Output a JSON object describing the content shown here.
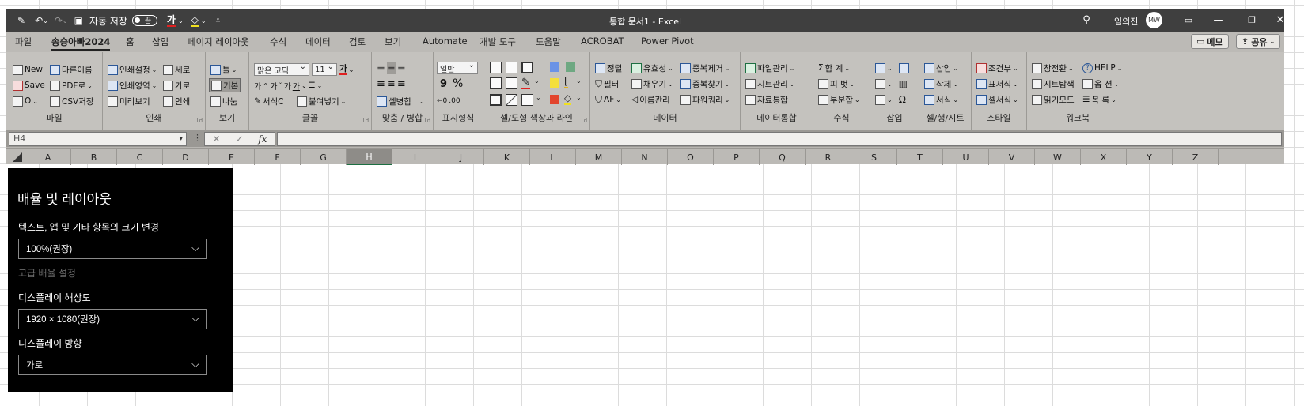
{
  "titlebar": {
    "autosave_label": "자동 저장",
    "autosave_state": "끔",
    "font_color_glyph": "가",
    "document_title": "통합 문서1  -  Excel",
    "user_name": "임의진",
    "avatar_text": "MW"
  },
  "menu": {
    "items": [
      "파일",
      "송승아빠2024",
      "홈",
      "삽입",
      "페이지 레이아웃",
      "수식",
      "데이터",
      "검토",
      "보기",
      "Automate",
      "개발 도구",
      "도움말",
      "ACROBAT",
      "Power Pivot"
    ],
    "memo_label": "메모",
    "share_label": "공유"
  },
  "ribbon": {
    "file": {
      "new": "New",
      "other_name": "다른이름",
      "save": "Save",
      "pdf": "PDF로",
      "o": "O",
      "csv": "CSV저장",
      "label": "파일"
    },
    "print": {
      "print_setup": "인쇄설정",
      "vertical": "세로",
      "print_area": "인쇄영역",
      "horizontal": "가로",
      "preview": "미리보기",
      "print": "인쇄",
      "label": "인쇄"
    },
    "view": {
      "frame": "틀",
      "basic": "기본",
      "split": "나눔",
      "label": "보기"
    },
    "font": {
      "font_name": "맑은 고딕",
      "font_size": "11",
      "font_color": "가",
      "format": "서식C",
      "paste": "붙여넣기",
      "label": "글꼴"
    },
    "align": {
      "merge": "셀병합",
      "label": "맞춤 / 병합"
    },
    "number": {
      "format": "일반",
      "comma": "9",
      "percent": "%",
      "label": "표시형식"
    },
    "cell_color": {
      "label": "셀/도형 색상과 라인"
    },
    "data": {
      "sort": "정렬",
      "validate": "유효성",
      "dedupe": "중복제거",
      "filter": "필터",
      "fill": "채우기",
      "find_dup": "중복찾기",
      "af": "AF",
      "name_mgr": "이름관리",
      "power_query": "파워쿼리",
      "label": "데이터"
    },
    "consolidate": {
      "file_mgr": "파일관리",
      "sheet_mgr": "시트관리",
      "data_merge": "자료통합",
      "label": "데이터통합"
    },
    "formula": {
      "sum": "합  계",
      "pivot": "피  벗",
      "subtotal": "부분합",
      "label": "수식"
    },
    "insert": {
      "label": "삽입"
    },
    "cells": {
      "insert": "삽입",
      "delete": "삭제",
      "format": "서식",
      "label": "셀/행/시트"
    },
    "style": {
      "conditional": "조건부",
      "table_format": "표서식",
      "cell_style": "셀서식",
      "label": "스타일"
    },
    "workbook": {
      "switch": "창전환",
      "help": "HELP",
      "sheet_explorer": "시트탐색",
      "options": "옵  션",
      "reading": "읽기모드",
      "toc": "목  록",
      "label": "워크북"
    }
  },
  "formula_bar": {
    "name_box": "H4",
    "fx": "fx"
  },
  "columns": [
    "A",
    "B",
    "C",
    "D",
    "E",
    "F",
    "G",
    "H",
    "I",
    "J",
    "K",
    "L",
    "M",
    "N",
    "O",
    "P",
    "Q",
    "R",
    "S",
    "T",
    "U",
    "V",
    "W",
    "X",
    "Y",
    "Z"
  ],
  "selected_column": "H",
  "settings": {
    "title": "배율 및 레이아웃",
    "scale_label": "텍스트, 앱 및 기타 항목의 크기 변경",
    "scale_value": "100%(권장)",
    "advanced_scale": "고급 배율 설정",
    "resolution_label": "디스플레이 해상도",
    "resolution_value": "1920 × 1080(권장)",
    "orientation_label": "디스플레이 방향",
    "orientation_value": "가로"
  }
}
